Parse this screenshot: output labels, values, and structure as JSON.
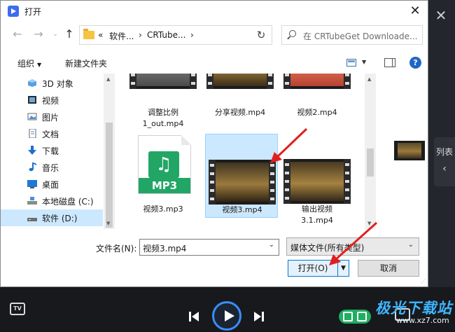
{
  "dialog": {
    "title": "打开",
    "close_symbol": "✕"
  },
  "nav": {
    "back_symbol": "←",
    "forward_symbol": "→",
    "up_symbol": "↑",
    "refresh_symbol": "↻",
    "breadcrumb": [
      "«",
      "软件...",
      "›",
      "CRTube...",
      "›"
    ],
    "search_placeholder": "在 CRTubeGet Downloade..."
  },
  "toolbar": {
    "organize_label": "组织",
    "organize_caret": "▼",
    "new_folder_label": "新建文件夹",
    "help_label": "?"
  },
  "sidebar": {
    "items": [
      {
        "label": "3D 对象",
        "icon": "3d-objects-icon"
      },
      {
        "label": "视频",
        "icon": "video-folder-icon"
      },
      {
        "label": "图片",
        "icon": "pictures-folder-icon"
      },
      {
        "label": "文档",
        "icon": "documents-folder-icon"
      },
      {
        "label": "下载",
        "icon": "download-arrow-icon"
      },
      {
        "label": "音乐",
        "icon": "music-note-icon"
      },
      {
        "label": "桌面",
        "icon": "desktop-icon"
      },
      {
        "label": "本地磁盘 (C:)",
        "icon": "drive-icon"
      },
      {
        "label": "软件 (D:)",
        "icon": "drive-icon",
        "selected": true
      }
    ]
  },
  "files": [
    {
      "name_line1": "调整比例",
      "name_line2": "1_out.mp4",
      "kind": "video-thumbnail"
    },
    {
      "name_line1": "分享视频.mp4",
      "name_line2": "",
      "kind": "video-thumbnail"
    },
    {
      "name_line1": "视频2.mp4",
      "name_line2": "",
      "kind": "video-thumbnail"
    },
    {
      "name_line1": "视频3.mp3",
      "name_line2": "",
      "kind": "mp3-file-icon",
      "badge": "MP3"
    },
    {
      "name_line1": "视频3.mp4",
      "name_line2": "",
      "kind": "video-thumbnail",
      "selected": true
    },
    {
      "name_line1": "输出视频",
      "name_line2": "3.1.mp4",
      "kind": "video-thumbnail"
    }
  ],
  "form": {
    "filename_label": "文件名(N):",
    "filename_value": "视频3.mp4",
    "filetype_value": "媒体文件(所有类型)",
    "open_label": "打开(O)",
    "cancel_label": "取消"
  },
  "app": {
    "close_symbol": "✕",
    "list_tab_label": "列表",
    "list_tab_chevron": "‹",
    "tv_label": "TV",
    "watermark_main": "极光下载站",
    "watermark_sub": "www.xz7.com"
  },
  "colors": {
    "accent": "#0078d7",
    "selection": "#cce8ff",
    "player_blue": "#3a8dff",
    "mp3_green": "#21a665",
    "annotation_red": "#e02020"
  }
}
